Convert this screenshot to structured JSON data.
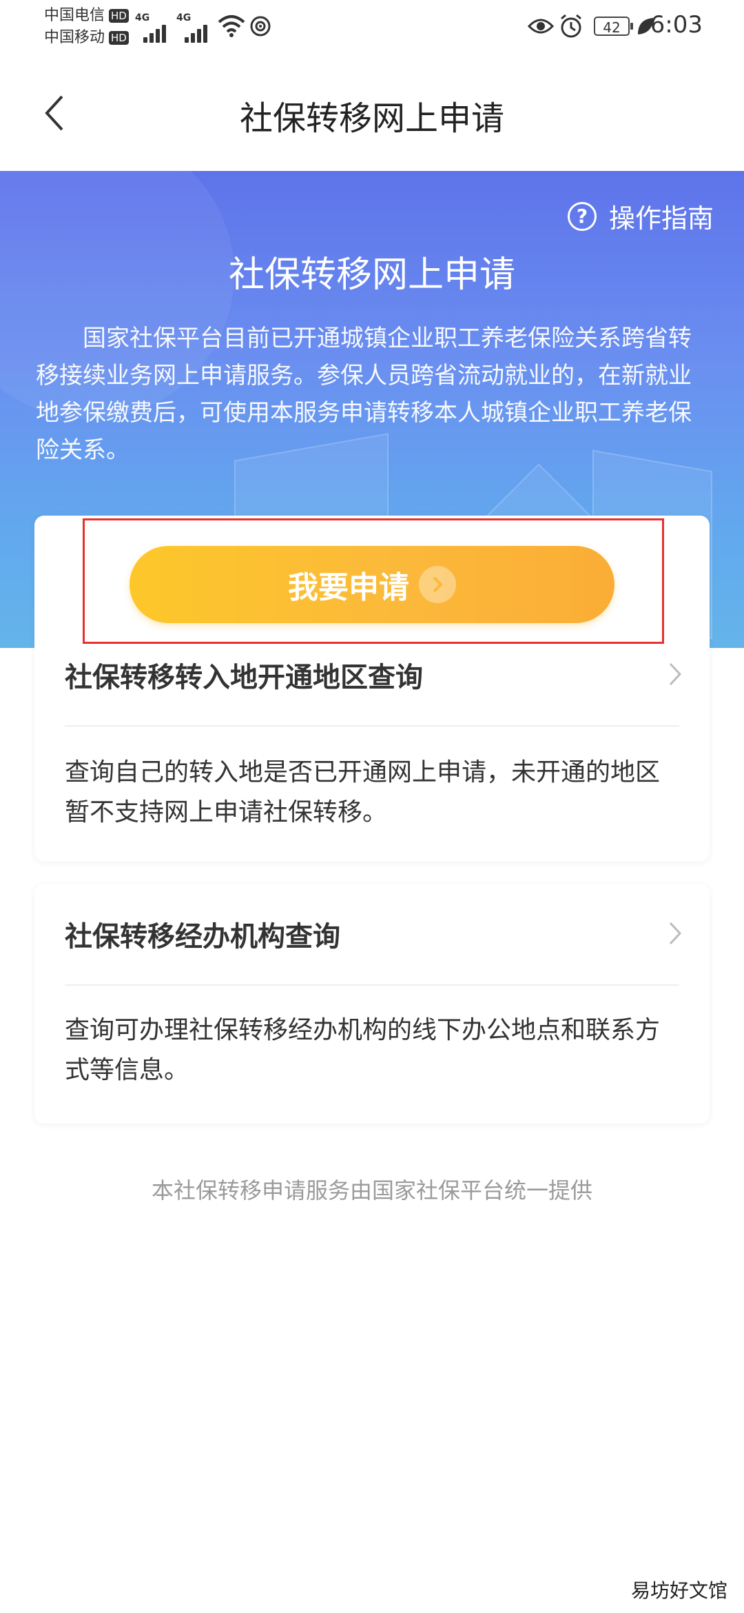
{
  "status_bar": {
    "carrier1": "中国电信",
    "carrier2": "中国移动",
    "hd": "HD",
    "net1": "4G",
    "net2": "4G",
    "battery": "42",
    "time": "6:03"
  },
  "header": {
    "title": "社保转移网上申请"
  },
  "banner": {
    "guide_label": "操作指南",
    "title": "社保转移网上申请",
    "description": "国家社保平台目前已开通城镇企业职工养老保险关系跨省转移接续业务网上申请服务。参保人员跨省流动就业的，在新就业地参保缴费后，可使用本服务申请转移本人城镇企业职工养老保险关系。"
  },
  "apply_button": {
    "label": "我要申请"
  },
  "cards": [
    {
      "title": "社保转移转入地开通地区查询",
      "description": "查询自己的转入地是否已开通网上申请，未开通的地区暂不支持网上申请社保转移。"
    },
    {
      "title": "社保转移经办机构查询",
      "description": "查询可办理社保转移经办机构的线下办公地点和联系方式等信息。"
    }
  ],
  "footer": {
    "text": "本社保转移申请服务由国家社保平台统一提供"
  },
  "watermark": {
    "text": "易坊好文馆"
  },
  "colors": {
    "banner_top": "#5e73ea",
    "banner_bottom": "#64b4ea",
    "button_left": "#fdc72a",
    "button_right": "#fbad35",
    "highlight": "#e8302e"
  }
}
